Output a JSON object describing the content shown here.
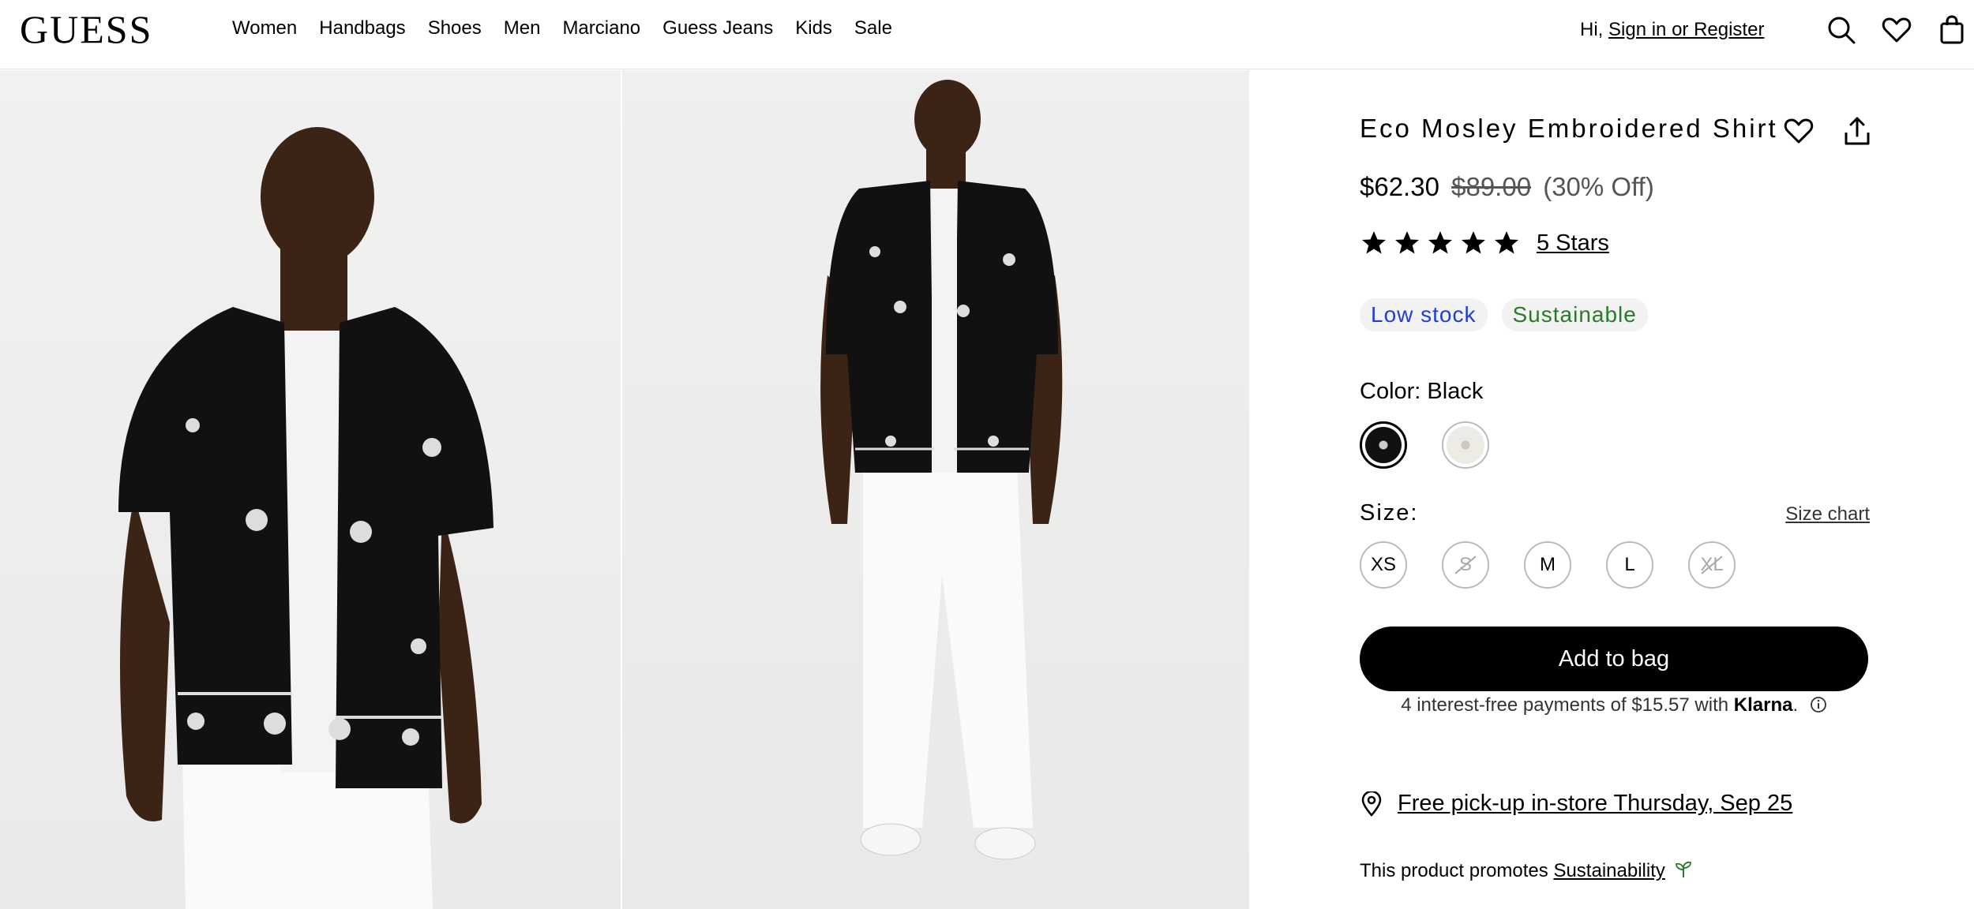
{
  "header": {
    "logo": "GUESS",
    "nav": [
      "Women",
      "Handbags",
      "Shoes",
      "Men",
      "Marciano",
      "Guess Jeans",
      "Kids",
      "Sale"
    ],
    "greeting": "Hi,",
    "sign_in_label": "Sign in or Register",
    "icons": [
      "search-icon",
      "heart-icon",
      "bag-icon"
    ]
  },
  "product": {
    "title": "Eco Mosley Embroidered Shirt",
    "price_now": "$62.30",
    "price_old": "$89.00",
    "discount": "(30% Off)",
    "rating": 5,
    "rating_label": "5 Stars",
    "badges": [
      "Low stock",
      "Sustainable"
    ],
    "color_label": "Color:",
    "color_value": "Black",
    "size_label": "Size:",
    "size_chart_label": "Size chart",
    "sizes": [
      {
        "label": "XS",
        "available": true
      },
      {
        "label": "S",
        "available": false
      },
      {
        "label": "M",
        "available": true
      },
      {
        "label": "L",
        "available": true
      },
      {
        "label": "XL",
        "available": false
      }
    ],
    "add_to_bag_label": "Add to bag",
    "klarna_prefix": "4 interest-free payments of $15.57 with",
    "klarna_brand": "Klarna",
    "klarna_suffix": ".",
    "pickup_label": "Free pick-up in-store Thursday, Sep 25",
    "promo_prefix": "This product promotes",
    "promo_link": "Sustainability"
  },
  "colors": {
    "accent_low_stock": "#1f3ed6",
    "accent_sustainable": "#2a7a2a",
    "button_bg": "#000000"
  }
}
